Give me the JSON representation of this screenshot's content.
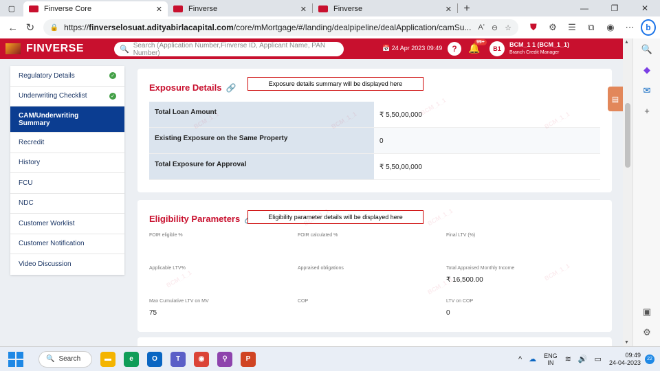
{
  "browser": {
    "tabs": [
      {
        "title": "Finverse Core",
        "active": true
      },
      {
        "title": "Finverse",
        "active": false
      },
      {
        "title": "Finverse",
        "active": false
      }
    ],
    "url_prefix": "https://",
    "url_domain": "finverselosuat.adityabirlacapital.com",
    "url_path": "/core/mMortgage/#/landing/dealpipeline/dealApplication/camSu...",
    "read_aloud": "Aʹ"
  },
  "app": {
    "logo": "FINVERSE",
    "search_placeholder": "Search (Application Number,Finverse ID, Applicant Name, PAN Number)",
    "datetime": "24 Apr 2023 09:49",
    "notification_count": "99+",
    "avatar_initials": "B1",
    "user_name": "BCM_1 1 (BCM_1_1)",
    "user_role": "Branch Credit Manager"
  },
  "sidebar": {
    "items": [
      {
        "label": "Regulatory Details",
        "checked": true
      },
      {
        "label": "Underwriting Checklist",
        "checked": true
      },
      {
        "label": "CAM/Underwriting Summary",
        "active": true
      },
      {
        "label": "Recredit"
      },
      {
        "label": "History"
      },
      {
        "label": "FCU"
      },
      {
        "label": "NDC"
      },
      {
        "label": "Customer Worklist"
      },
      {
        "label": "Customer Notification"
      },
      {
        "label": "Video Discussion"
      }
    ]
  },
  "exposure": {
    "title": "Exposure Details",
    "annotation": "Exposure details summary will be displayed here",
    "rows": [
      {
        "label": "Total Loan Amount",
        "value": "₹ 5,50,00,000"
      },
      {
        "label": "Existing Exposure on the Same Property",
        "value": "0"
      },
      {
        "label": "Total Exposure for Approval",
        "value": "₹ 5,50,00,000"
      }
    ]
  },
  "eligibility": {
    "title": "Eligibility Parameters",
    "annotation": "Eligibility parameter details will be displayed here",
    "fields": [
      {
        "label": "FOIR eligible %",
        "value": ""
      },
      {
        "label": "FOIR calculated %",
        "value": ""
      },
      {
        "label": "Final LTV (%)",
        "value": ""
      },
      {
        "label": "Applicable LTV%",
        "value": ""
      },
      {
        "label": "Appraised obligations",
        "value": ""
      },
      {
        "label": "Total Appraised Monthly Income",
        "value": "₹ 16,500.00"
      },
      {
        "label": "Max Cumulative LTV on MV",
        "value": "75"
      },
      {
        "label": "COP",
        "value": ""
      },
      {
        "label": "LTV on COP",
        "value": "0"
      }
    ]
  },
  "watermark": "BCM_1_1",
  "taskbar": {
    "search_label": "Search",
    "lang_line1": "ENG",
    "lang_line2": "IN",
    "time": "09:49",
    "date": "24-04-2023",
    "notification_count": "22"
  }
}
